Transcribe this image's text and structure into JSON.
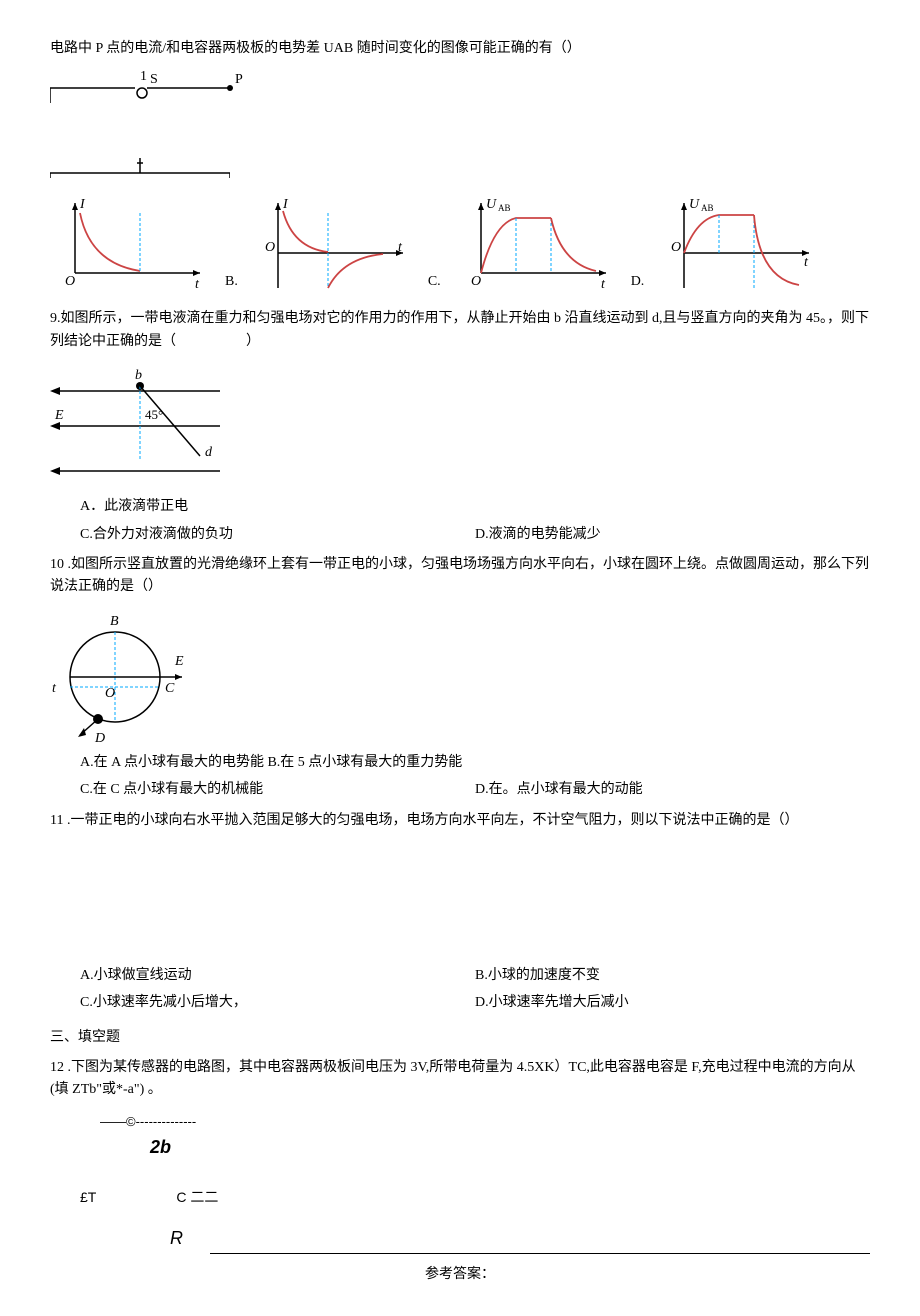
{
  "q8": {
    "text": "电路中 P 点的电流/和电容器两极板的电势差 UAB 随时间变化的图像可能正确的有（）",
    "circuit": {
      "label1": "1",
      "labelS": "S",
      "labelP": "P"
    },
    "graphs": {
      "axisI": "I",
      "axisU": "U",
      "axisUAB": "AB",
      "axisT": "t",
      "axisO": "O",
      "labelB": "B.",
      "labelC": "C.",
      "labelD": "D."
    }
  },
  "q9": {
    "text": "9.如图所示，一带电液滴在重力和匀强电场对它的作用力的作用下，从静止开始由 b 沿直线运动到 d,且与竖直方向的夹角为 45。，则下列结论中正确的是（　　　　　）",
    "diagram": {
      "labelB": "b",
      "labelE": "E",
      "labelAngle": "45°",
      "labelD": "d"
    },
    "optA": "A．此液滴带正电",
    "optC": "C.合外力对液滴做的负功",
    "optD": "D.液滴的电势能减少"
  },
  "q10": {
    "text": "10 .如图所示竖直放置的光滑绝缘环上套有一带正电的小球，匀强电场场强方向水平向右，小球在圆环上绕。点做圆周运动，那么下列说法正确的是（）",
    "diagram": {
      "labelB": "B",
      "labelE": "E",
      "labelC": "C",
      "labelO": "O",
      "labelD": "D"
    },
    "optA": "A.在 A 点小球有最大的电势能 B.在 5 点小球有最大的重力势能",
    "optC": "C.在 C 点小球有最大的机械能",
    "optD": "D.在。点小球有最大的动能"
  },
  "q11": {
    "text": "11 .一带正电的小球向右水平抛入范围足够大的匀强电场，电场方向水平向左，不计空气阻力，则以下说法中正确的是（）",
    "optA": "A.小球做宣线运动",
    "optB": "B.小球的加速度不变",
    "optC": "C.小球速率先减小后增大，",
    "optD": "D.小球速率先增大后减小"
  },
  "section3": "三、填空题",
  "q12": {
    "text": "12 .下图为某传感器的电路图，其中电容器两极板间电压为 3V,所带电荷量为 4.5XK）TC,此电容器电容是 F,充电过程中电流的方向从(填 ZTb\"或*-a\") 。",
    "dash": "——©--------------",
    "label2b": "2b",
    "labelET": "£T",
    "labelC": "C 二二",
    "labelR": "R"
  },
  "answerTitle": "参考答案："
}
